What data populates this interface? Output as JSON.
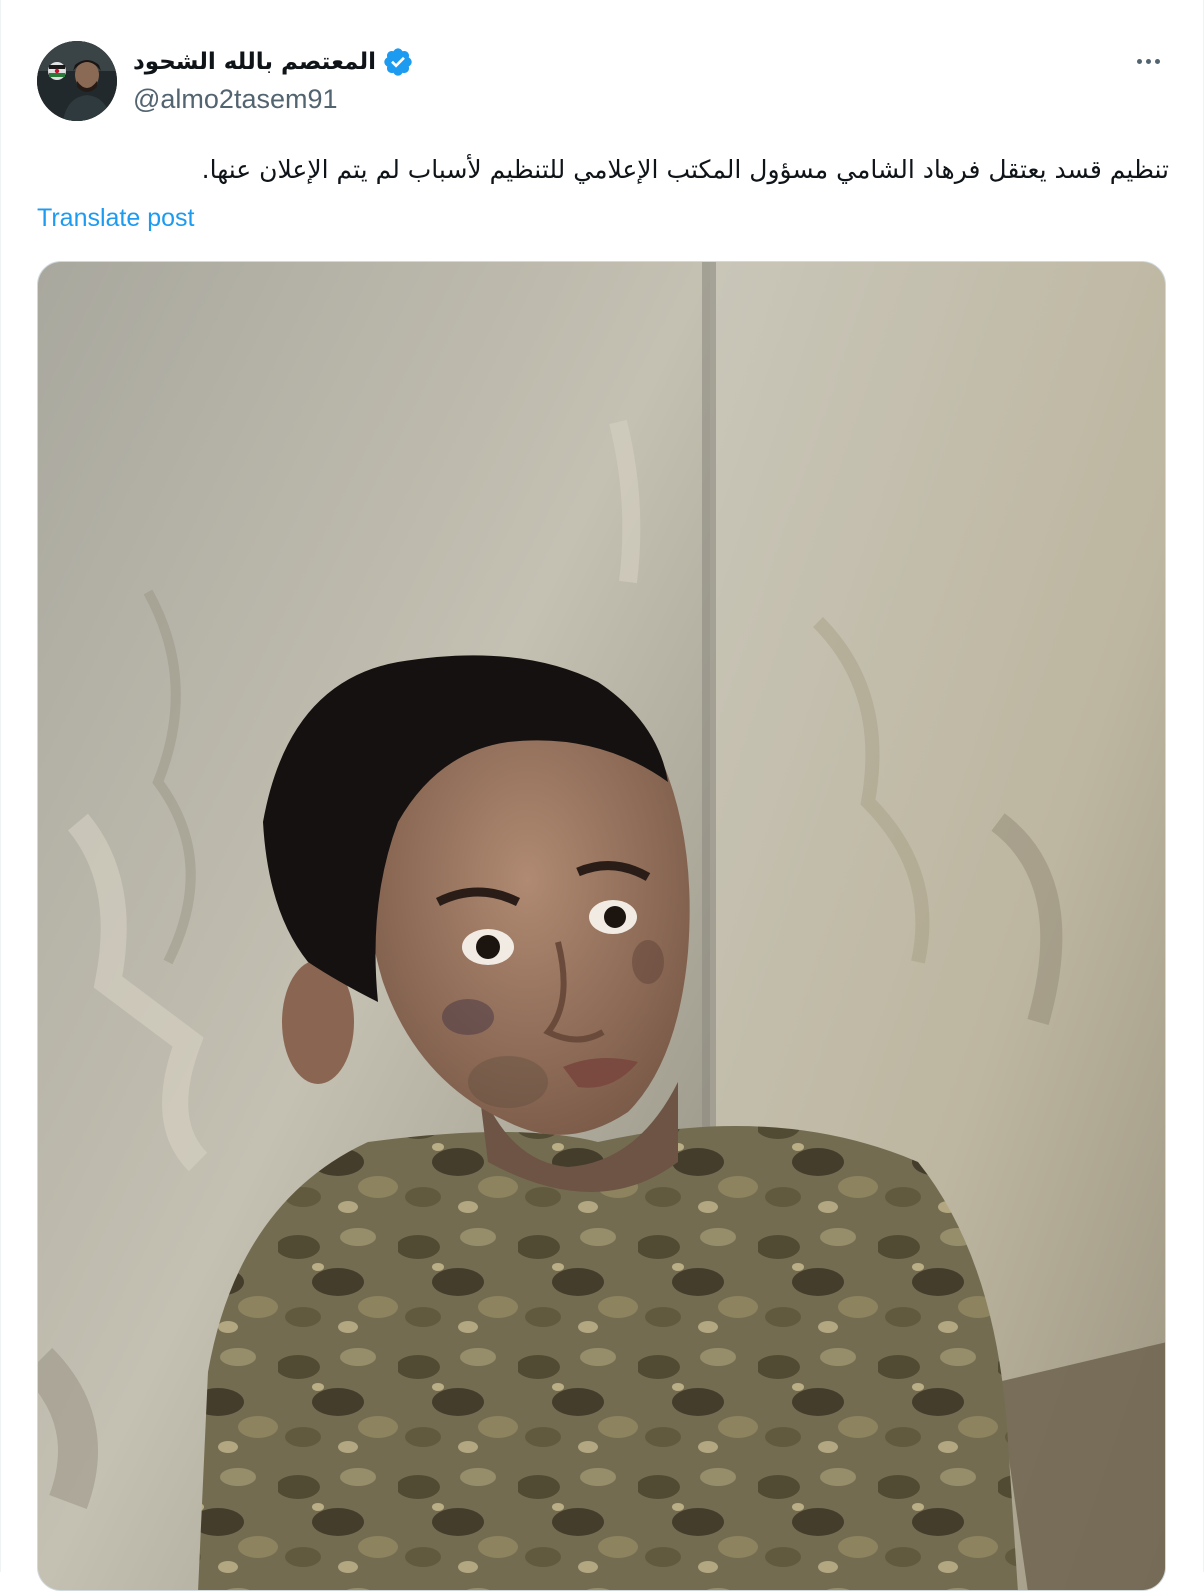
{
  "post": {
    "author": {
      "display_name": "المعتصم بالله الشحود",
      "handle": "@almo2tasem91",
      "verified": true,
      "avatar_icon": "profile-photo"
    },
    "text": "تنظيم قسد يعتقل فرهاد الشامي مسؤول المكتب الإعلامي للتنظيم لأسباب لم يتم الإعلان عنها.",
    "translate_label": "Translate post",
    "more_icon": "ellipsis-icon",
    "media": {
      "type": "photo",
      "description_icon": "attached-photo"
    }
  },
  "colors": {
    "text_primary": "#0f1419",
    "text_secondary": "#536471",
    "link": "#1d9bf0",
    "verified_badge": "#1d9bf0",
    "border": "#cfd9de"
  }
}
